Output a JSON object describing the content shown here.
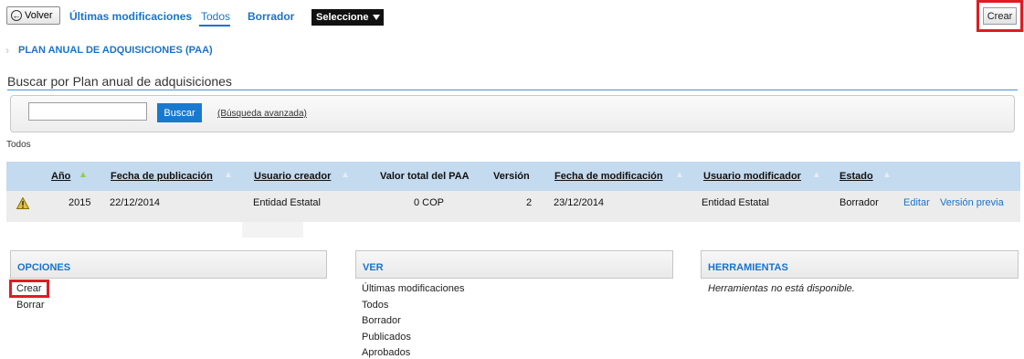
{
  "toolbar": {
    "back_label": "Volver",
    "links": [
      "Últimas modificaciones",
      "Todos",
      "Borrador"
    ],
    "select_value": "Seleccione",
    "create_label": "Crear"
  },
  "breadcrumb": {
    "item": "PLAN ANUAL DE ADQUISICIONES (PAA)"
  },
  "search": {
    "title": "Buscar por Plan anual de adquisiciones",
    "input_value": "",
    "button_label": "Buscar",
    "advanced_link": "(Búsqueda avanzada)"
  },
  "filter_label": "Todos",
  "table": {
    "headers": [
      "Año",
      "Fecha de publicación",
      "Usuario creador",
      "Valor total del PAA",
      "Versión",
      "Fecha de modificación",
      "Usuario modificador",
      "Estado"
    ],
    "rows": [
      {
        "year": "2015",
        "published": "22/12/2014",
        "creator": "Entidad Estatal",
        "total": "0 COP",
        "version": "2",
        "modified": "23/12/2014",
        "modifier": "Entidad Estatal",
        "status": "Borrador",
        "edit": "Editar",
        "preview": "Versión previa"
      }
    ]
  },
  "panels": {
    "options": {
      "title": "OPCIONES",
      "items": [
        "Crear",
        "Borrar"
      ]
    },
    "view": {
      "title": "VER",
      "items": [
        "Últimas modificaciones",
        "Todos",
        "Borrador",
        "Publicados",
        "Aprobados"
      ]
    },
    "tools": {
      "title": "HERRAMIENTAS",
      "message": "Herramientas no está disponible."
    }
  },
  "colors": {
    "accent": "#1a73c9",
    "highlight": "#e01b24",
    "table_header": "#c3daef"
  }
}
